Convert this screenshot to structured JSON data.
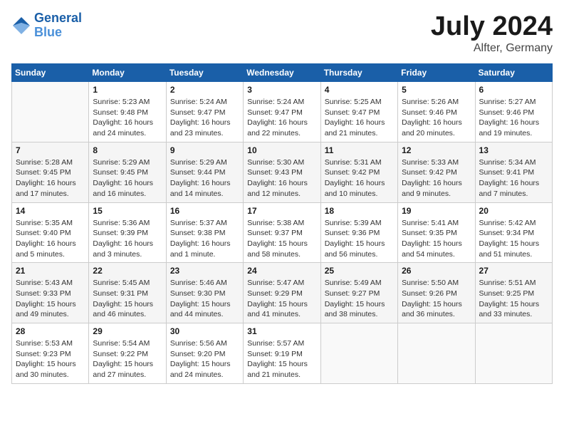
{
  "header": {
    "logo": {
      "line1": "General",
      "line2": "Blue"
    },
    "title": "July 2024",
    "location": "Alfter, Germany"
  },
  "columns": [
    "Sunday",
    "Monday",
    "Tuesday",
    "Wednesday",
    "Thursday",
    "Friday",
    "Saturday"
  ],
  "weeks": [
    [
      {
        "day": "",
        "info": ""
      },
      {
        "day": "1",
        "info": "Sunrise: 5:23 AM\nSunset: 9:48 PM\nDaylight: 16 hours\nand 24 minutes."
      },
      {
        "day": "2",
        "info": "Sunrise: 5:24 AM\nSunset: 9:47 PM\nDaylight: 16 hours\nand 23 minutes."
      },
      {
        "day": "3",
        "info": "Sunrise: 5:24 AM\nSunset: 9:47 PM\nDaylight: 16 hours\nand 22 minutes."
      },
      {
        "day": "4",
        "info": "Sunrise: 5:25 AM\nSunset: 9:47 PM\nDaylight: 16 hours\nand 21 minutes."
      },
      {
        "day": "5",
        "info": "Sunrise: 5:26 AM\nSunset: 9:46 PM\nDaylight: 16 hours\nand 20 minutes."
      },
      {
        "day": "6",
        "info": "Sunrise: 5:27 AM\nSunset: 9:46 PM\nDaylight: 16 hours\nand 19 minutes."
      }
    ],
    [
      {
        "day": "7",
        "info": "Sunrise: 5:28 AM\nSunset: 9:45 PM\nDaylight: 16 hours\nand 17 minutes."
      },
      {
        "day": "8",
        "info": "Sunrise: 5:29 AM\nSunset: 9:45 PM\nDaylight: 16 hours\nand 16 minutes."
      },
      {
        "day": "9",
        "info": "Sunrise: 5:29 AM\nSunset: 9:44 PM\nDaylight: 16 hours\nand 14 minutes."
      },
      {
        "day": "10",
        "info": "Sunrise: 5:30 AM\nSunset: 9:43 PM\nDaylight: 16 hours\nand 12 minutes."
      },
      {
        "day": "11",
        "info": "Sunrise: 5:31 AM\nSunset: 9:42 PM\nDaylight: 16 hours\nand 10 minutes."
      },
      {
        "day": "12",
        "info": "Sunrise: 5:33 AM\nSunset: 9:42 PM\nDaylight: 16 hours\nand 9 minutes."
      },
      {
        "day": "13",
        "info": "Sunrise: 5:34 AM\nSunset: 9:41 PM\nDaylight: 16 hours\nand 7 minutes."
      }
    ],
    [
      {
        "day": "14",
        "info": "Sunrise: 5:35 AM\nSunset: 9:40 PM\nDaylight: 16 hours\nand 5 minutes."
      },
      {
        "day": "15",
        "info": "Sunrise: 5:36 AM\nSunset: 9:39 PM\nDaylight: 16 hours\nand 3 minutes."
      },
      {
        "day": "16",
        "info": "Sunrise: 5:37 AM\nSunset: 9:38 PM\nDaylight: 16 hours\nand 1 minute."
      },
      {
        "day": "17",
        "info": "Sunrise: 5:38 AM\nSunset: 9:37 PM\nDaylight: 15 hours\nand 58 minutes."
      },
      {
        "day": "18",
        "info": "Sunrise: 5:39 AM\nSunset: 9:36 PM\nDaylight: 15 hours\nand 56 minutes."
      },
      {
        "day": "19",
        "info": "Sunrise: 5:41 AM\nSunset: 9:35 PM\nDaylight: 15 hours\nand 54 minutes."
      },
      {
        "day": "20",
        "info": "Sunrise: 5:42 AM\nSunset: 9:34 PM\nDaylight: 15 hours\nand 51 minutes."
      }
    ],
    [
      {
        "day": "21",
        "info": "Sunrise: 5:43 AM\nSunset: 9:33 PM\nDaylight: 15 hours\nand 49 minutes."
      },
      {
        "day": "22",
        "info": "Sunrise: 5:45 AM\nSunset: 9:31 PM\nDaylight: 15 hours\nand 46 minutes."
      },
      {
        "day": "23",
        "info": "Sunrise: 5:46 AM\nSunset: 9:30 PM\nDaylight: 15 hours\nand 44 minutes."
      },
      {
        "day": "24",
        "info": "Sunrise: 5:47 AM\nSunset: 9:29 PM\nDaylight: 15 hours\nand 41 minutes."
      },
      {
        "day": "25",
        "info": "Sunrise: 5:49 AM\nSunset: 9:27 PM\nDaylight: 15 hours\nand 38 minutes."
      },
      {
        "day": "26",
        "info": "Sunrise: 5:50 AM\nSunset: 9:26 PM\nDaylight: 15 hours\nand 36 minutes."
      },
      {
        "day": "27",
        "info": "Sunrise: 5:51 AM\nSunset: 9:25 PM\nDaylight: 15 hours\nand 33 minutes."
      }
    ],
    [
      {
        "day": "28",
        "info": "Sunrise: 5:53 AM\nSunset: 9:23 PM\nDaylight: 15 hours\nand 30 minutes."
      },
      {
        "day": "29",
        "info": "Sunrise: 5:54 AM\nSunset: 9:22 PM\nDaylight: 15 hours\nand 27 minutes."
      },
      {
        "day": "30",
        "info": "Sunrise: 5:56 AM\nSunset: 9:20 PM\nDaylight: 15 hours\nand 24 minutes."
      },
      {
        "day": "31",
        "info": "Sunrise: 5:57 AM\nSunset: 9:19 PM\nDaylight: 15 hours\nand 21 minutes."
      },
      {
        "day": "",
        "info": ""
      },
      {
        "day": "",
        "info": ""
      },
      {
        "day": "",
        "info": ""
      }
    ]
  ]
}
